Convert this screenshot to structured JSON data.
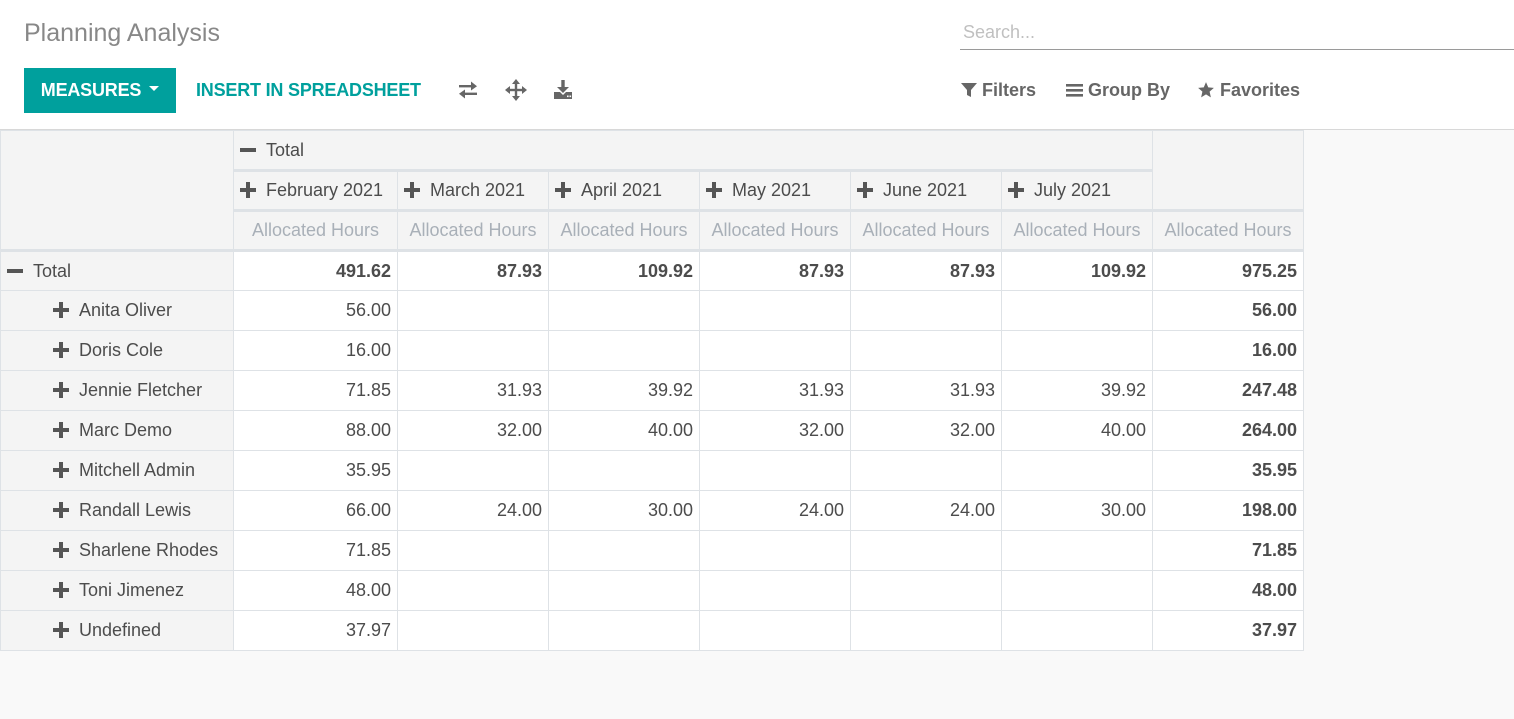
{
  "header": {
    "title": "Planning Analysis",
    "search_placeholder": "Search..."
  },
  "toolbar": {
    "measures_label": "MEASURES",
    "insert_label": "INSERT IN SPREADSHEET",
    "icons": [
      "flip-axis-icon",
      "expand-all-icon",
      "download-icon"
    ]
  },
  "search_options": {
    "filters_label": "Filters",
    "groupby_label": "Group By",
    "favorites_label": "Favorites"
  },
  "colors": {
    "primary": "#00a09d",
    "muted_header": "#a9b0b8"
  },
  "pivot": {
    "col_total_label": "Total",
    "columns": [
      "February 2021",
      "March 2021",
      "April 2021",
      "May 2021",
      "June 2021",
      "July 2021"
    ],
    "measure": "Allocated Hours",
    "total_row": {
      "label": "Total",
      "values": [
        "491.62",
        "87.93",
        "109.92",
        "87.93",
        "87.93",
        "109.92"
      ],
      "total": "975.25"
    },
    "rows": [
      {
        "label": "Anita Oliver",
        "values": [
          "56.00",
          "",
          "",
          "",
          "",
          ""
        ],
        "total": "56.00"
      },
      {
        "label": "Doris Cole",
        "values": [
          "16.00",
          "",
          "",
          "",
          "",
          ""
        ],
        "total": "16.00"
      },
      {
        "label": "Jennie Fletcher",
        "values": [
          "71.85",
          "31.93",
          "39.92",
          "31.93",
          "31.93",
          "39.92"
        ],
        "total": "247.48"
      },
      {
        "label": "Marc Demo",
        "values": [
          "88.00",
          "32.00",
          "40.00",
          "32.00",
          "32.00",
          "40.00"
        ],
        "total": "264.00"
      },
      {
        "label": "Mitchell Admin",
        "values": [
          "35.95",
          "",
          "",
          "",
          "",
          ""
        ],
        "total": "35.95"
      },
      {
        "label": "Randall Lewis",
        "values": [
          "66.00",
          "24.00",
          "30.00",
          "24.00",
          "24.00",
          "30.00"
        ],
        "total": "198.00"
      },
      {
        "label": "Sharlene Rhodes",
        "values": [
          "71.85",
          "",
          "",
          "",
          "",
          ""
        ],
        "total": "71.85"
      },
      {
        "label": "Toni Jimenez",
        "values": [
          "48.00",
          "",
          "",
          "",
          "",
          ""
        ],
        "total": "48.00"
      },
      {
        "label": "Undefined",
        "values": [
          "37.97",
          "",
          "",
          "",
          "",
          ""
        ],
        "total": "37.97"
      }
    ]
  }
}
